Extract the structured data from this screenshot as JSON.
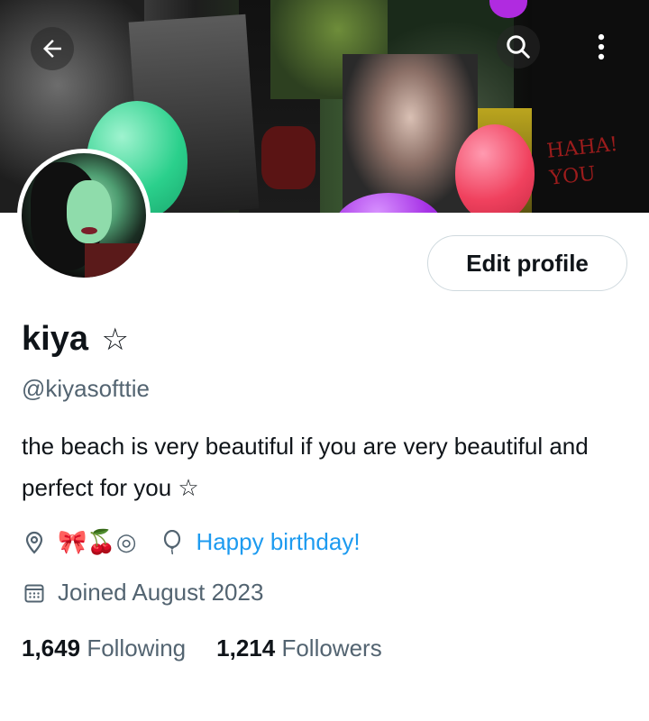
{
  "banner": {
    "caption_text": "HAHA! YOU"
  },
  "header": {
    "back_icon": "arrow-left-icon",
    "search_icon": "search-icon",
    "more_icon": "more-vertical-icon"
  },
  "profile": {
    "edit_button_label": "Edit profile",
    "display_name": "kiya",
    "name_star": "☆",
    "handle": "@kiyasofttie",
    "bio": "the beach is very beautiful if you are very beautiful and perfect for you ☆",
    "location_emojis": "🎀🍒◎",
    "birthday_text": "Happy birthday!",
    "joined_text": "Joined August 2023"
  },
  "stats": {
    "following_count": "1,649",
    "following_label": "Following",
    "followers_count": "1,214",
    "followers_label": "Followers"
  },
  "colors": {
    "link": "#1d9bf0",
    "secondary_text": "#536471",
    "primary_text": "#0f1419"
  }
}
